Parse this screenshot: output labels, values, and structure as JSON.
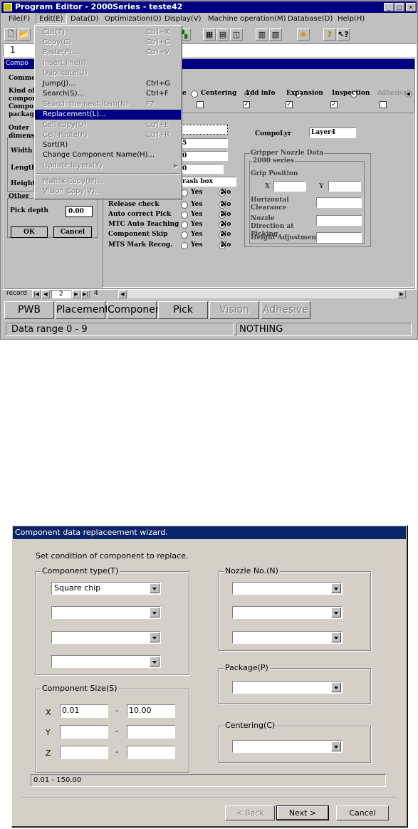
{
  "editor": {
    "title": "Program Editor - 2000Series - teste42",
    "menubar": [
      "File(F)",
      "Edit(E)",
      "Data(D)",
      "Optimization(O)",
      "Display(V)",
      "Machine operation(M)",
      "Database(D)",
      "Help(H)"
    ],
    "row_indicator": "1",
    "edit_menu": [
      {
        "label": "Cut(T)",
        "shortcut": "Ctrl+X",
        "enabled": false
      },
      {
        "label": "Copy(C)",
        "shortcut": "Ctrl+C",
        "enabled": false
      },
      {
        "label": "Paste(P)...",
        "shortcut": "Ctrl+V",
        "enabled": false
      },
      {
        "label": "Insert line(I)",
        "shortcut": "",
        "enabled": false
      },
      {
        "label": "Duplicate(U)",
        "shortcut": "",
        "enabled": false
      },
      {
        "label": "Jump(J)...",
        "shortcut": "Ctrl+G",
        "enabled": true
      },
      {
        "label": "Search(S)...",
        "shortcut": "Ctrl+F",
        "enabled": true
      },
      {
        "label": "Search the next item(N)",
        "shortcut": "F7",
        "enabled": false
      },
      {
        "label": "Replacement(L)...",
        "shortcut": "",
        "enabled": true,
        "selected": true
      },
      {
        "label": "Cell copy(O)",
        "shortcut": "Ctrl+E",
        "enabled": false
      },
      {
        "label": "Cell Paste(P)",
        "shortcut": "Ctrl+R",
        "enabled": false
      },
      {
        "label": "Sort(R)",
        "shortcut": "",
        "enabled": true
      },
      {
        "label": "Change Component Name(H)...",
        "shortcut": "",
        "enabled": true
      },
      {
        "label": "Update layers(Y)",
        "shortcut": "",
        "enabled": false,
        "submenu": true
      },
      {
        "label": "Matrix Copy(M)...",
        "shortcut": "",
        "enabled": false
      },
      {
        "label": "Vision Copy(V)...",
        "shortcut": "",
        "enabled": false
      }
    ],
    "dialog": {
      "title": "Compo",
      "left_labels": [
        "Commer",
        "Kind of",
        "compone",
        "Compone",
        "packagi",
        "Outer",
        "dimensio",
        "Width",
        "Length",
        "Height",
        "Other"
      ],
      "pick_depth_label": "Pick depth",
      "pick_depth_value": "0.00",
      "ok": "OK",
      "cancel": "Cancel",
      "options": {
        "centering_prefix": "e",
        "centering": "Centering",
        "add_info": "Add info",
        "expansion": "Expansion",
        "inspection": "Inspection",
        "adhesive": "Adhesive"
      },
      "field_values": [
        "5",
        "0",
        "0",
        "rash box"
      ],
      "compo_lyr_label": "CompoLyr",
      "compo_lyr_value": "Layer4",
      "gripper": {
        "title": "Gripper Nozzle Data",
        "subtitle": "2000 series",
        "grip_position": "Grip Position",
        "x": "X",
        "y": "Y",
        "horizontal": "Horizontal Clearance",
        "nozzle_direction": "Nozzle Direction at Picking",
        "height_adjustment": "Height Adjustment"
      },
      "checks": [
        {
          "label": "Release check",
          "value": "No"
        },
        {
          "label": "Auto correct Pick",
          "value": "No"
        },
        {
          "label": "MTC Auto Teaching",
          "value": "No"
        },
        {
          "label": "Component Skip",
          "value": "No"
        },
        {
          "label": "MTS Mark Recog.",
          "value": "No"
        }
      ],
      "yes": "Yes",
      "no": "No"
    },
    "record_nav": {
      "label": "record",
      "current": "2",
      "total": "4"
    },
    "tabs": [
      "PWB",
      "Placement",
      "Component",
      "Pick",
      "Vision",
      "Adhesive"
    ],
    "status": {
      "left": "Data range 0 - 9",
      "right": "NOTHING"
    }
  },
  "wizard": {
    "title": "Component data replaceement wizard.",
    "instruction": "Set condition of component to replace.",
    "component_type": {
      "label": "Component type(T)",
      "values": [
        "Square chip",
        "",
        "",
        ""
      ]
    },
    "component_size": {
      "label": "Component Size(S)",
      "x_label": "X",
      "y_label": "Y",
      "z_label": "Z",
      "x_min": "0.01",
      "x_max": "10.00",
      "y_min": "",
      "y_max": "",
      "z_min": "",
      "z_max": "",
      "dash": "-"
    },
    "nozzle": {
      "label": "Nozzle No.(N)",
      "values": [
        "",
        "",
        ""
      ]
    },
    "package": {
      "label": "Package(P)",
      "value": ""
    },
    "centering": {
      "label": "Centering(C)",
      "value": ""
    },
    "range": "0.01 - 150.00",
    "buttons": {
      "back": "< Back",
      "next": "Next >",
      "cancel": "Cancel"
    }
  }
}
